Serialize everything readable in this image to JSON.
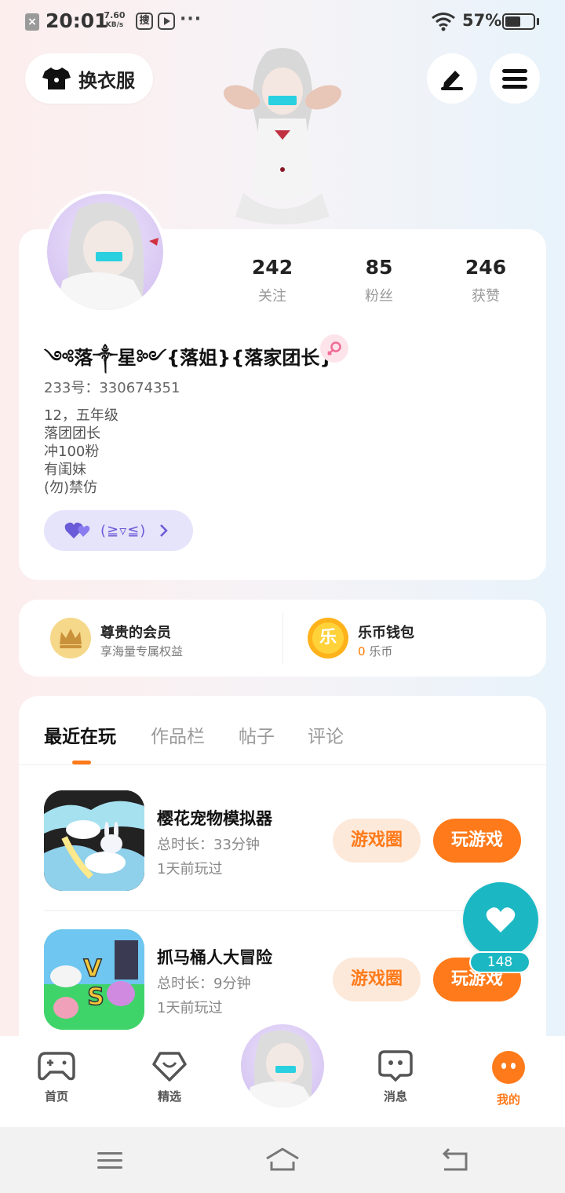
{
  "status_bar": {
    "time": "20:01",
    "net_speed_value": "7.60",
    "net_speed_unit": "KB/s",
    "sou_label": "搜",
    "more": "···",
    "battery_percent": "57%",
    "battery_level": 0.57
  },
  "top": {
    "outfit_label": "换衣服",
    "edit_icon": "pen-icon",
    "menu_icon": "hamburger-menu-icon"
  },
  "profile": {
    "stats": [
      {
        "value": "242",
        "label": "关注"
      },
      {
        "value": "85",
        "label": "粉丝"
      },
      {
        "value": "246",
        "label": "获赞"
      }
    ],
    "nickname": "༺落༒星༻{落姐}{落家团长}",
    "gender_icon": "female-icon",
    "uid": "233号：330674351",
    "bio": [
      "12，五年级",
      "落团团长",
      "冲100粉",
      "有闺妹",
      "(勿)禁仿"
    ],
    "emote_text": "(≧▿≦)"
  },
  "member": {
    "title": "尊贵的会员",
    "subtitle": "享海量专属权益"
  },
  "wallet": {
    "icon_char": "乐",
    "title": "乐币钱包",
    "balance": "0",
    "unit": "乐币"
  },
  "tabs": [
    "最近在玩",
    "作品栏",
    "帖子",
    "评论"
  ],
  "games": [
    {
      "name": "樱花宠物模拟器",
      "duration": "总时长：33分钟",
      "last_played": "1天前玩过",
      "circle_btn": "游戏圈",
      "play_btn": "玩游戏"
    },
    {
      "name": "抓马桶人大冒险",
      "duration": "总时长：9分钟",
      "last_played": "1天前玩过",
      "circle_btn": "游戏圈",
      "play_btn": "玩游戏"
    }
  ],
  "float_like": {
    "count": "148"
  },
  "bottom_nav": [
    {
      "label": "首页",
      "icon": "gamepad-icon"
    },
    {
      "label": "精选",
      "icon": "heart-shield-icon"
    },
    {
      "label": "",
      "icon": "avatar"
    },
    {
      "label": "消息",
      "icon": "chat-bubble-icon"
    },
    {
      "label": "我的",
      "icon": "me-face-icon"
    }
  ],
  "colors": {
    "accent": "#ff7a1a",
    "teal": "#1bb8c4",
    "emote_purple": "#6a5bd8"
  }
}
